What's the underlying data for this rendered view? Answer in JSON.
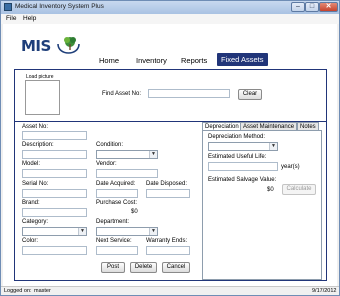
{
  "window": {
    "title": "Medical Inventory System Plus",
    "close_glyph": "✕",
    "min_glyph": "–",
    "max_glyph": "□"
  },
  "menu": {
    "file": "File",
    "help": "Help"
  },
  "logo": {
    "text": "MIS"
  },
  "nav": {
    "home": "Home",
    "inventory": "Inventory",
    "reports": "Reports",
    "fixed_assets": "Fixed Assets"
  },
  "top": {
    "load_picture": "Load picture",
    "find_label": "Find Asset No:",
    "find_value": "",
    "clear_label": "Clear"
  },
  "form": {
    "asset_no": "Asset No:",
    "description": "Description:",
    "condition": "Condition:",
    "model": "Model:",
    "vendor": "Vendor:",
    "serial_no": "Serial No:",
    "date_acquired": "Date Acquired:",
    "date_disposed": "Date Disposed:",
    "brand": "Brand:",
    "purchase_cost": "Purchase Cost:",
    "purchase_cost_value": "$0",
    "category": "Category:",
    "department": "Department:",
    "color": "Color:",
    "next_service": "Next Service:",
    "warranty_ends": "Warranty Ends:"
  },
  "buttons": {
    "post": "Post",
    "delete": "Delete",
    "cancel": "Cancel"
  },
  "tabs": {
    "depreciation": "Depreciation",
    "asset_maintenance": "Asset Maintenance",
    "notes": "Notes"
  },
  "depreciation": {
    "method_label": "Depreciation Method:",
    "useful_life_label": "Estimated Useful Life:",
    "years": "year(s)",
    "salvage_label": "Estimated Salvage Value:",
    "salvage_value": "$0",
    "calculate": "Calculate"
  },
  "status": {
    "logged_on_label": "Logged on:",
    "user": "master",
    "date": "9/17/2012"
  },
  "colors": {
    "accent": "#213579",
    "logo": "#1f3f7a"
  }
}
